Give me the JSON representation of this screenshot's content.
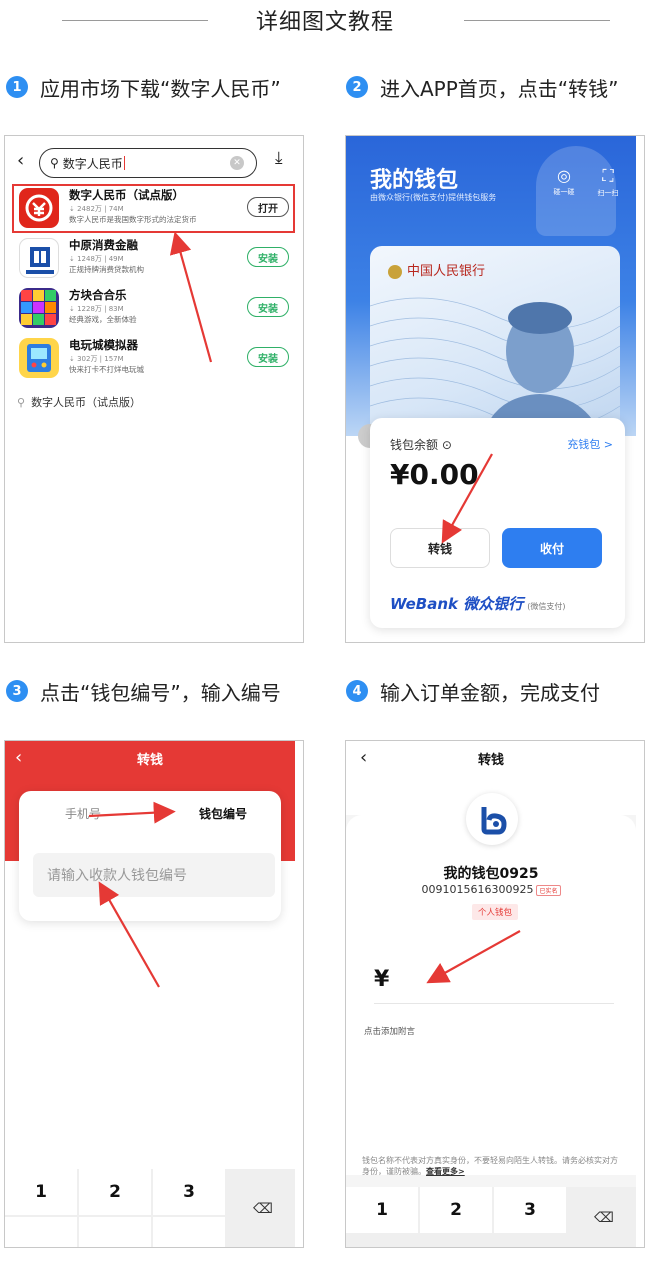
{
  "header": {
    "title": "详细图文教程"
  },
  "steps": [
    {
      "num": "1",
      "text": "应用市场下载“数字人民币”"
    },
    {
      "num": "2",
      "text": "进入APP首页，点击“转钱”"
    },
    {
      "num": "3",
      "text": "点击“钱包编号”，输入编号"
    },
    {
      "num": "4",
      "text": "输入订单金额，完成支付"
    }
  ],
  "store": {
    "search_value": "数字人民币",
    "apps": [
      {
        "name": "数字人民币（试点版）",
        "meta": "⇣ 2482万 | 74M",
        "desc": "数字人民币是我国数字形式的法定货币",
        "button": "打开"
      },
      {
        "name": "中原消费金融",
        "meta": "⇣ 1248万 | 49M",
        "desc": "正规持牌消费贷款机构",
        "button": "安装"
      },
      {
        "name": "方块合合乐",
        "meta": "⇣ 1228万 | 83M",
        "desc": "经典游戏，全新体验",
        "button": "安装"
      },
      {
        "name": "电玩城模拟器",
        "meta": "⇣ 302万 | 157M",
        "desc": "快来打卡不打烊电玩城",
        "button": "安装"
      }
    ],
    "suggestion": "数字人民币（试点版）"
  },
  "wallet": {
    "title": "我的钱包",
    "subtitle": "由微众银行(微信支付)提供钱包服务",
    "scan1": "碰一碰",
    "scan2": "扫一扫",
    "bank_name": "中国人民银行",
    "balance_label": "钱包余额 ⊙",
    "recharge": "充钱包 >",
    "balance": "¥0.00",
    "transfer": "转钱",
    "receive": "收付",
    "webank": "WeBank 微众银行",
    "webank_sub": "(微信支付)"
  },
  "transfer": {
    "title": "转钱",
    "tab_phone": "手机号",
    "tab_wallet": "钱包编号",
    "input_placeholder": "请输入收款人钱包编号",
    "keys": [
      "1",
      "2",
      "3"
    ]
  },
  "pay": {
    "title": "转钱",
    "wallet_name": "我的钱包0925",
    "wallet_no": "0091015616300925",
    "wallet_tag": "已实名",
    "badge": "个人钱包",
    "currency": "¥",
    "note": "点击添加附言",
    "warning": "钱包名称不代表对方真实身份，不要轻易向陌生人转钱。请务必核实对方身份，谨防被骗。",
    "more": "查看更多>",
    "keys": [
      "1",
      "2",
      "3"
    ]
  },
  "colors": {
    "accent_blue": "#2e8ff2",
    "red": "#e53935",
    "green": "#2fb067",
    "wallet_blue": "#2a66d9"
  }
}
